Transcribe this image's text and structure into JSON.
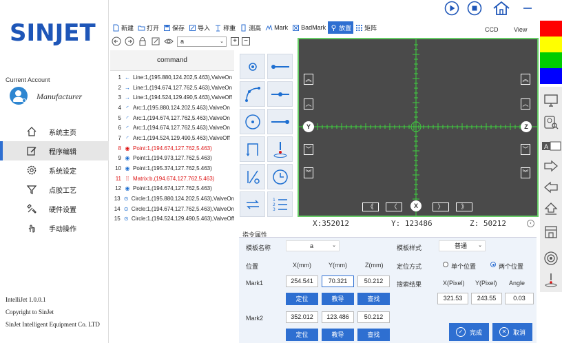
{
  "brand": {
    "logo": "SINJET"
  },
  "account": {
    "label": "Current Account",
    "name": "Manufacturer"
  },
  "nav": [
    {
      "label": "系统主页",
      "icon": "home-icon"
    },
    {
      "label": "程序编辑",
      "icon": "edit-icon",
      "active": true
    },
    {
      "label": "系统设定",
      "icon": "gear-icon"
    },
    {
      "label": "点胶工艺",
      "icon": "funnel-icon"
    },
    {
      "label": "硬件设置",
      "icon": "tools-icon"
    },
    {
      "label": "手动操作",
      "icon": "hand-icon"
    }
  ],
  "about": {
    "version": "IntelliJet 1.0.0.1",
    "copyright": "Copyright to SinJet",
    "company": "SinJet Intelligent Equipment Co. LTD"
  },
  "toolbar": {
    "new": "新建",
    "open": "打开",
    "save": "保存",
    "import": "导入",
    "weigh": "称重",
    "height": "测高",
    "mark": "Mark",
    "badmark": "BadMark",
    "position": "放置",
    "matrix": "矩阵"
  },
  "command_select": {
    "value": "a"
  },
  "command_list": {
    "header": "command",
    "rows": [
      {
        "num": "1",
        "icon": "←",
        "text": "Line:1,(195.880,124.202,5.463),ValveOn",
        "red": false
      },
      {
        "num": "2",
        "icon": "→",
        "text": "Line:1,(194.674,127.762,5.463),ValveOn",
        "red": false
      },
      {
        "num": "3",
        "icon": "→",
        "text": "Line:1,(194.524,129.490,5.463),ValveOff",
        "red": false
      },
      {
        "num": "4",
        "icon": "◜",
        "text": "Arc:1,(195.880,124.202,5.463),ValveOn",
        "red": false
      },
      {
        "num": "5",
        "icon": "◜",
        "text": "Arc:1,(194.674,127.762,5.463),ValveOn",
        "red": false
      },
      {
        "num": "6",
        "icon": "◜",
        "text": "Arc:1,(194.674,127.762,5.463),ValveOn",
        "red": false
      },
      {
        "num": "7",
        "icon": "◜",
        "text": "Arc:1,(194.524,129.490,5.463),ValveOff",
        "red": false
      },
      {
        "num": "8",
        "icon": "◉",
        "text": "Point:1,(194.674,127.762,5.463)",
        "red": true
      },
      {
        "num": "9",
        "icon": "◉",
        "text": "Point:1,(194.973,127.762,5.463)",
        "red": false
      },
      {
        "num": "10",
        "icon": "◉",
        "text": "Point:1,(195.374,127.762,5.463)",
        "red": false
      },
      {
        "num": "11",
        "icon": "⁞⁞",
        "text": "Matrix:b,(194.674,127.762,5.463)",
        "red": true
      },
      {
        "num": "12",
        "icon": "◉",
        "text": "Point:1,(194.674,127.762,5.463)",
        "red": false
      },
      {
        "num": "13",
        "icon": "⊙",
        "text": "Circle:1,(195.880,124.202,5.463),ValveOn",
        "red": false
      },
      {
        "num": "14",
        "icon": "⊙",
        "text": "Circle:1,(194.674,127.762,5.463),ValveOn",
        "red": false
      },
      {
        "num": "15",
        "icon": "⊙",
        "text": "Circle:1,(194.524,129.490,5.463),ValveOff",
        "red": false
      }
    ]
  },
  "ccd": {
    "tab_ccd": "CCD",
    "tab_view": "View",
    "y_label": "Y",
    "z_label": "Z",
    "x_label": "X"
  },
  "coords": {
    "x": "X:352012",
    "y": "Y: 123486",
    "z": "Z: 50212"
  },
  "props": {
    "title": "指令属性",
    "template_name_label": "模板名称",
    "template_name_value": "a",
    "template_style_label": "模板样式",
    "template_style_value": "普通",
    "position_label": "位置",
    "x_col": "X(mm)",
    "y_col": "Y(mm)",
    "z_col": "Z(mm)",
    "locate_mode_label": "定位方式",
    "single_label": "单个位置",
    "double_label": "两个位置",
    "mark1_label": "Mark1",
    "mark1_x": "254.541",
    "mark1_y": "70.321",
    "mark1_z": "50.212",
    "search_result_label": "搜索结果",
    "xpix_label": "X(Pixel)",
    "ypix_label": "Y(Pixel)",
    "angle_label": "Angle",
    "xpix_value": "321.53",
    "ypix_value": "243.55",
    "angle_value": "0.03",
    "locate_btn": "定位",
    "teach_btn": "教导",
    "search_btn": "查找",
    "mark2_label": "Mark2",
    "mark2_x": "352.012",
    "mark2_y": "123.486",
    "mark2_z": "50.212",
    "done_btn": "完成",
    "cancel_btn": "取消"
  },
  "colors": {
    "accent": "#2e6fd1",
    "swatches": [
      "#ff0000",
      "#ffff00",
      "#00cc00",
      "#0000ff"
    ]
  }
}
